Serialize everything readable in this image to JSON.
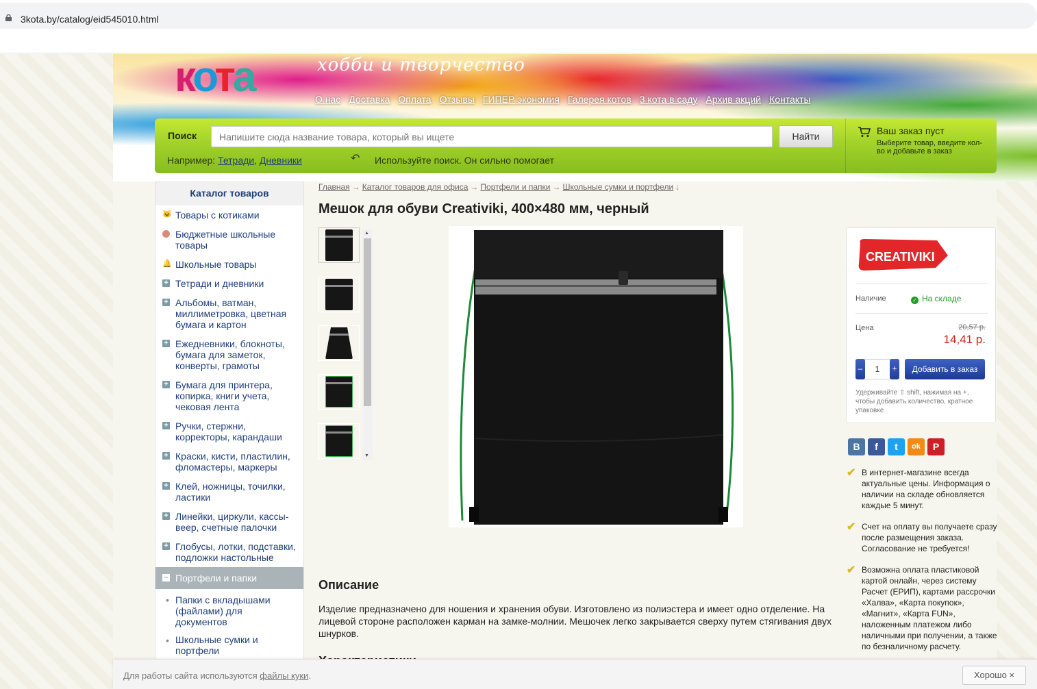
{
  "browser": {
    "url": "3kota.by/catalog/eid545010.html"
  },
  "header": {
    "logo": [
      "к",
      "о",
      "т",
      "а"
    ],
    "slogan": "хобби и творчество",
    "nav": [
      "О нас",
      "Доставка",
      "Оплата",
      "Отзывы",
      "ГИПЕР экономия",
      "Галерея котов",
      "3 кота в саду",
      "Архив акций",
      "Контакты"
    ]
  },
  "search": {
    "label": "Поиск",
    "placeholder": "Напишите сюда название товара, который вы ищете",
    "button": "Найти",
    "example_prefix": "Например: ",
    "examples": [
      "Тетради",
      "Дневники"
    ],
    "hint": "Используйте поиск. Он сильно помогает"
  },
  "cart": {
    "icon": "cart-icon",
    "title": "Ваш заказ пуст",
    "subtitle": "Выберите товар, введите кол-во и добавьте в заказ"
  },
  "sidebar": {
    "title": "Каталог товаров",
    "items": [
      {
        "label": "Товары с котиками",
        "icon": "cat-icon"
      },
      {
        "label": "Бюджетные школьные товары",
        "icon": "coin-icon"
      },
      {
        "label": "Школьные товары",
        "icon": "bell-icon"
      },
      {
        "label": "Тетради и дневники",
        "icon": "plus-icon"
      },
      {
        "label": "Альбомы, ватман, миллиметровка, цветная бумага и картон",
        "icon": "plus-icon"
      },
      {
        "label": "Ежедневники, блокноты, бумага для заметок, конверты, грамоты",
        "icon": "plus-icon"
      },
      {
        "label": "Бумага для принтера, копирка, книги учета, чековая лента",
        "icon": "plus-icon"
      },
      {
        "label": "Ручки, стержни, корректоры, карандаши",
        "icon": "plus-icon"
      },
      {
        "label": "Краски, кисти, пластилин, фломастеры, маркеры",
        "icon": "plus-icon"
      },
      {
        "label": "Клей, ножницы, точилки, ластики",
        "icon": "plus-icon"
      },
      {
        "label": "Линейки, циркули, кассы-веер, счетные палочки",
        "icon": "plus-icon"
      },
      {
        "label": "Глобусы, лотки, подставки, подложки настольные",
        "icon": "plus-icon"
      },
      {
        "label": "Портфели и папки",
        "icon": "minus-icon"
      }
    ],
    "subitems": [
      "Папки с вкладышами (файлами) для документов",
      "Школьные сумки и портфели"
    ]
  },
  "breadcrumbs": [
    "Главная",
    "Каталог товаров для офиса",
    "Портфели и папки",
    "Школьные сумки и портфели"
  ],
  "product": {
    "title": "Мешок для обуви Creativiki, 400×480 мм, черный",
    "brand": "CREATIVIKI",
    "availability_label": "Наличие",
    "availability": "На складе",
    "price_label": "Цена",
    "old_price": "20,57 р.",
    "price": "14,41 р.",
    "qty": "1",
    "qty_minus": "–",
    "qty_plus": "+",
    "add_button": "Добавить в заказ",
    "qty_note": "Удерживайте ⇧ shift, нажимая на +, чтобы добавить количество, кратное упаковке"
  },
  "description": {
    "heading": "Описание",
    "text": "Изделие предназначено для ношения и хранения обуви. Изготовлено из полиэстера и имеет одно отделение. На лицевой стороне расположен карман на замке-молнии. Мешочек легко закрывается сверху путем стягивания двух шнурков.",
    "next_heading": "Характеристики"
  },
  "social": [
    "В",
    "f",
    "t",
    "ok",
    "P"
  ],
  "info": [
    "В интернет-магазине всегда актуальные цены. Информация о наличии на складе обновляется каждые 5 минут.",
    "Счет на оплату вы получаете сразу после размещения заказа. Согласование не требуется!",
    "Возможна оплата пластиковой картой онлайн, через систему Расчет (ЕРИП), картами рассрочки «Халва», «Карта покупок», «Магнит», «Карта FUN», наложенным платежом либо наличными при получении, а также по безналичному расчету."
  ],
  "cookie": {
    "text": "Для работы сайта используются ",
    "link": "файлы куки",
    "dot": ".",
    "button": "Хорошо ×"
  }
}
